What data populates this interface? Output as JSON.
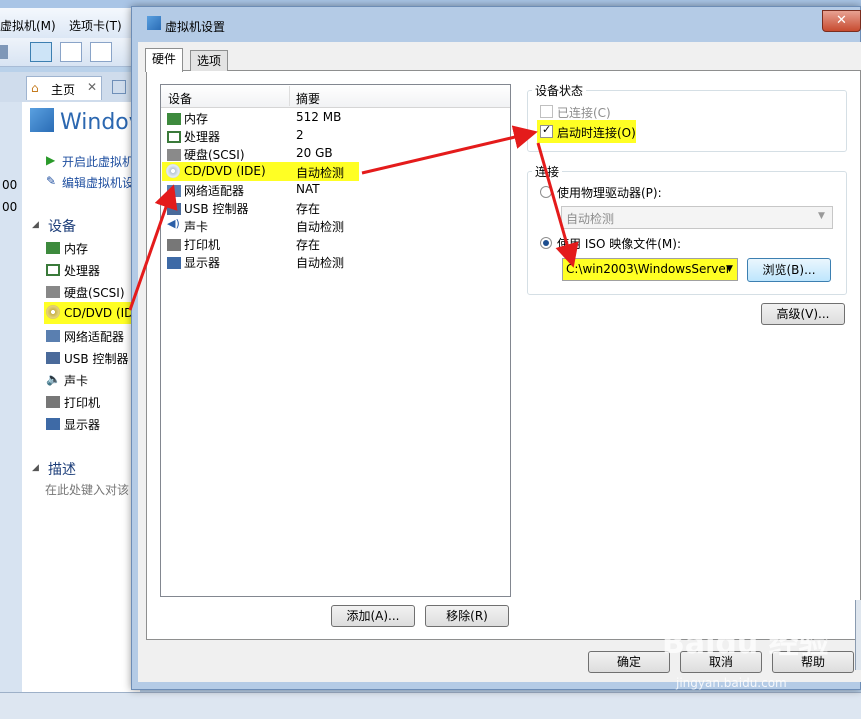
{
  "background": {
    "menu": [
      "虚拟机(M)",
      "选项卡(T)"
    ],
    "left_numbers": [
      "00",
      "00"
    ],
    "tab_home": "主页",
    "title_partial": "Windov",
    "actions": [
      "开启此虚拟机",
      "编辑虚拟机设"
    ],
    "section_devices": "设备",
    "devices": [
      "内存",
      "处理器",
      "硬盘(SCSI)",
      "CD/DVD (IDE",
      "网络适配器",
      "USB 控制器",
      "声卡",
      "打印机",
      "显示器"
    ],
    "section_desc": "描述",
    "desc_placeholder": "在此处键入对该"
  },
  "dialog": {
    "title": "虚拟机设置",
    "close_glyph": "✕",
    "tabs": [
      "硬件",
      "选项"
    ],
    "columns": [
      "设备",
      "摘要"
    ],
    "devices": [
      {
        "name": "内存",
        "summary": "512 MB",
        "icon": "memory-icon"
      },
      {
        "name": "处理器",
        "summary": "2",
        "icon": "cpu-icon"
      },
      {
        "name": "硬盘(SCSI)",
        "summary": "20 GB",
        "icon": "harddisk-icon"
      },
      {
        "name": "CD/DVD (IDE)",
        "summary": "自动检测",
        "icon": "cdrom-icon"
      },
      {
        "name": "网络适配器",
        "summary": "NAT",
        "icon": "network-icon"
      },
      {
        "name": "USB 控制器",
        "summary": "存在",
        "icon": "usb-icon"
      },
      {
        "name": "声卡",
        "summary": "自动检测",
        "icon": "speaker-icon"
      },
      {
        "name": "打印机",
        "summary": "存在",
        "icon": "printer-icon"
      },
      {
        "name": "显示器",
        "summary": "自动检测",
        "icon": "monitor-icon"
      }
    ],
    "selected_index": 3,
    "add_button": "添加(A)...",
    "remove_button": "移除(R)",
    "device_status": {
      "title": "设备状态",
      "connected_label": "已连接(C)",
      "connected_checked": false,
      "connect_on_power_label": "启动时连接(O)",
      "connect_on_power_checked": true
    },
    "connection": {
      "title": "连接",
      "physical_label": "使用物理驱动器(P):",
      "physical_value": "自动检测",
      "iso_label": "使用 ISO 映像文件(M):",
      "iso_value": "C:\\win2003\\WindowsServer",
      "browse_button": "浏览(B)...",
      "selected": "iso"
    },
    "advanced_button": "高级(V)...",
    "ok_button": "确定",
    "cancel_button": "取消",
    "help_button": "帮助"
  },
  "watermark": {
    "logo": "Baidu 经验",
    "url": "jingyan.baidu.com"
  },
  "colors": {
    "highlight": "#ffff24",
    "arrow": "#e41b1b",
    "dialog_frame": "#b4cbe6"
  }
}
